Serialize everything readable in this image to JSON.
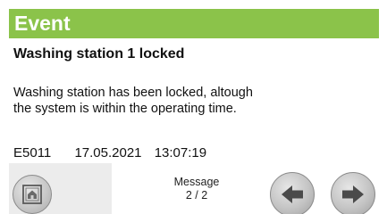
{
  "header": {
    "title": "Event"
  },
  "event": {
    "title": "Washing station 1 locked",
    "description": "Washing station has been locked, altough\nthe system is within the operating time.",
    "code": "E5011",
    "date": "17.05.2021",
    "time": "13:07:19"
  },
  "footer": {
    "message_label": "Message",
    "message_counter": "2 / 2",
    "home_icon": "home-icon",
    "prev_icon": "arrow-left-icon",
    "next_icon": "arrow-right-icon"
  },
  "colors": {
    "header_bg": "#8bc34a",
    "header_text": "#ffffff",
    "arrow": "#4a4a4a"
  }
}
